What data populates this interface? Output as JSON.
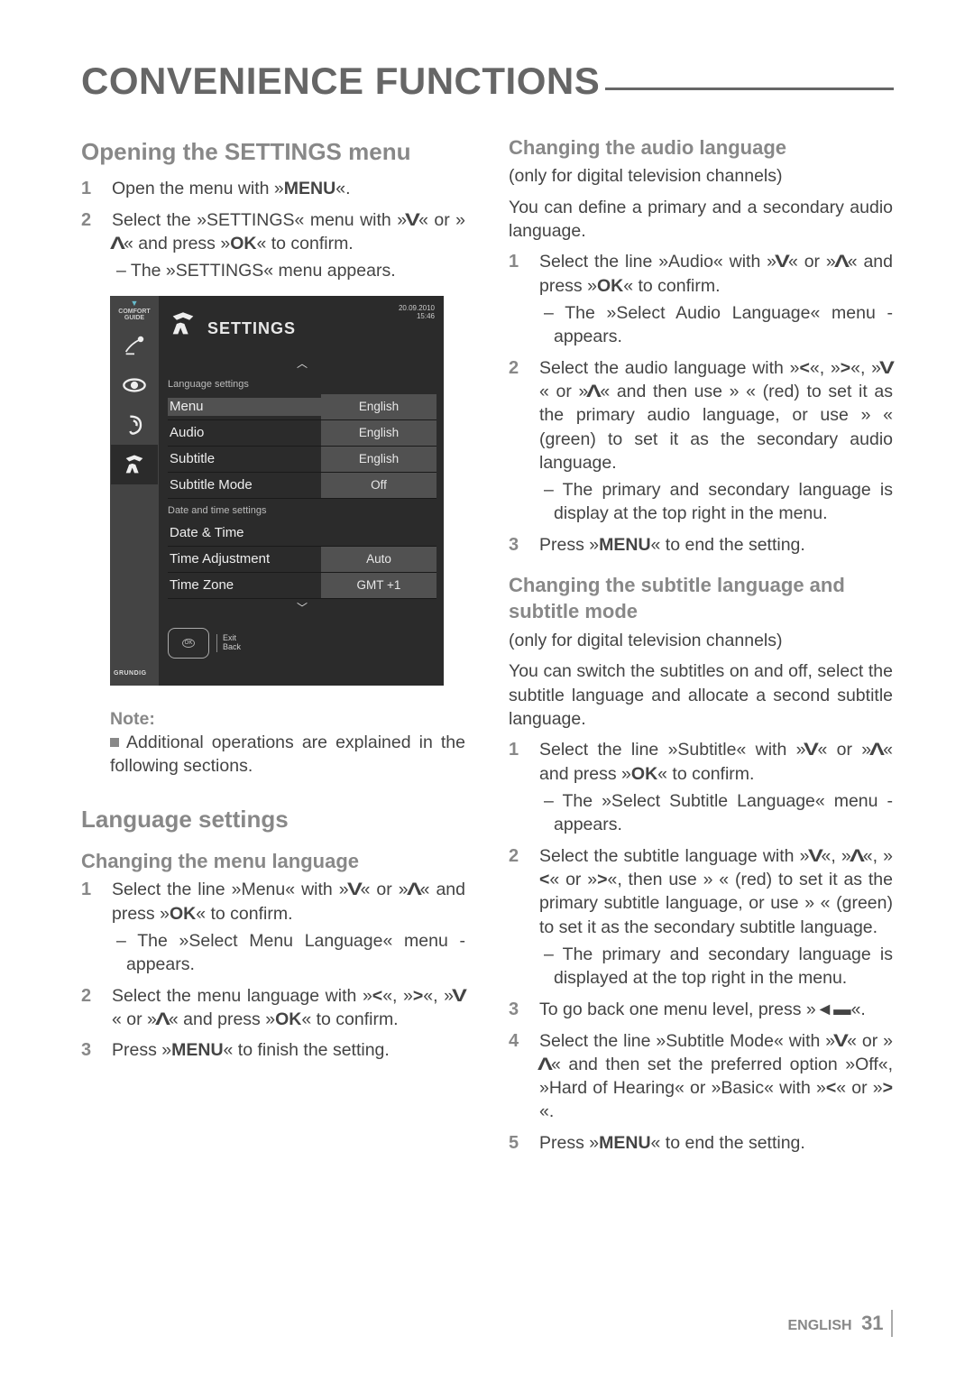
{
  "page_title": "CONVENIENCE FUNCTIONS",
  "footer": {
    "lang": "ENGLISH",
    "page": "31"
  },
  "left": {
    "h_open": "Opening the SETTINGS menu",
    "open_steps": {
      "s1": "Open the menu with »",
      "s1b": "«.",
      "s2a": "Select the »SETTINGS« menu with »",
      "s2b": "« or »",
      "s2c": "« and press »",
      "s2d": "« to confirm.",
      "s2_sub": "– The »SETTINGS« menu appears."
    },
    "kw_menu": "MENU",
    "kw_ok": "OK",
    "note_label": "Note:",
    "note_text": "Additional operations are explained in the following sections.",
    "h_lang": "Language settings",
    "h_menuLang": "Changing the menu language",
    "menuLang": {
      "s1a": "Select the line »Menu« with »",
      "s1b": "« or »",
      "s1c": "« and press »",
      "s1d": "« to confirm.",
      "s1_sub": "– The »Select Menu Language« menu ­appears.",
      "s2a": "Select the menu language with »",
      "s2b": "«, »",
      "s2c": "«, »",
      "s2d": "« or »",
      "s2e": "« and press »",
      "s2f": "« to confirm.",
      "s3a": "Press »",
      "s3b": "« to finish the setting."
    }
  },
  "right": {
    "h_audio": "Changing the audio language",
    "audio_note": "(only for digital television channels)",
    "audio_intro": "You can define a primary and a secondary audio language.",
    "audio": {
      "s1a": "Select the line »Audio« with »",
      "s1b": "« or »",
      "s1c": "« and press »",
      "s1d": "« to confirm.",
      "s1_sub": "– The »Select Audio Language« menu ­appears.",
      "s2a": "Select the audio language with »",
      "s2b": "«, »",
      "s2c": "«, »",
      "s2d": "« or »",
      "s2e": "« and then use »    « (red) to set it as the primary audio language, or use »    « (green) to set it as the secondary audio language.",
      "s2_sub": "– The primary and secondary language is display at the top right in the menu.",
      "s3a": "Press »",
      "s3b": "« to end the setting."
    },
    "h_sub": "Changing the subtitle language and subtitle mode",
    "sub_note": "(only for digital television channels)",
    "sub_intro": "You can switch the subtitles on and off, select the subtitle language and allocate a second subtitle language.",
    "sub": {
      "s1a": "Select the line »Subtitle« with »",
      "s1b": "« or »",
      "s1c": "« and press »",
      "s1d": "« to confirm.",
      "s1_sub": "– The »Select Subtitle Language« menu ­appears.",
      "s2a": "Select the subtitle language with »",
      "s2b": "«, »",
      "s2c": "«, »",
      "s2d": "« or »",
      "s2e": "«, then use »    « (red) to set it as the primary subtitle language, or use »    « (green) to set it as the secondary subtitle language.",
      "s2_sub": "– The primary and secondary language is displayed at the top right in the menu.",
      "s3a": "To go back one menu level, press »",
      "s3b": "«.",
      "s4a": "Select the line »Subtitle Mode« with »",
      "s4b": "« or »",
      "s4c": "« and then set the preferred option »Off«, »Hard of Hearing« or »Basic« with »",
      "s4d": "« or »",
      "s4e": "«.",
      "s5a": "Press »",
      "s5b": "« to end the setting."
    }
  },
  "menu": {
    "tab": "COMFORT GUIDE",
    "date": "20.09.2010",
    "time": "15:46",
    "title": "SETTINGS",
    "sec1": "Language settings",
    "rows1": [
      {
        "label": "Menu",
        "val": "English"
      },
      {
        "label": "Audio",
        "val": "English"
      },
      {
        "label": "Subtitle",
        "val": "English"
      },
      {
        "label": "Subtitle Mode",
        "val": "Off"
      }
    ],
    "sec2": "Date and time settings",
    "rows2": [
      {
        "label": "Date & Time",
        "val": ""
      },
      {
        "label": "Time Adjustment",
        "val": "Auto"
      },
      {
        "label": "Time Zone",
        "val": "GMT +1"
      }
    ],
    "remote": {
      "l1": "Exit",
      "l2": "Back",
      "ok": "OK"
    },
    "brand": "GRUNDIG"
  }
}
